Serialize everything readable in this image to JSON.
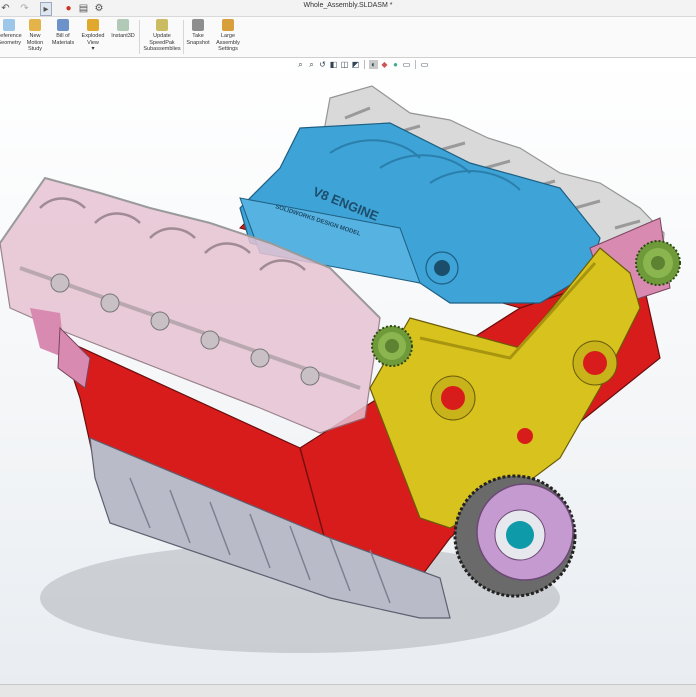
{
  "window": {
    "title": "Whole_Assembly.SLDASM *"
  },
  "quick_access": {
    "icons": [
      "undo-icon",
      "redo-icon",
      "select-icon",
      "rebuild-icon",
      "file-properties-icon",
      "options-icon"
    ]
  },
  "ribbon": {
    "buttons": [
      {
        "id": "reference-geometry",
        "label": "Reference\nGeometry",
        "icon": "reference-geometry-icon"
      },
      {
        "id": "new-motion-study",
        "label": "New\nMotion\nStudy",
        "icon": "motion-study-icon"
      },
      {
        "id": "bill-of-materials",
        "label": "Bill of\nMaterials",
        "icon": "bom-icon"
      },
      {
        "id": "exploded-view",
        "label": "Exploded\nView",
        "icon": "exploded-view-icon"
      },
      {
        "id": "instant3d",
        "label": "Instant3D",
        "icon": "instant3d-icon"
      },
      {
        "id": "update-speedpak",
        "label": "Update\nSpeedPak\nSubassemblies",
        "icon": "speedpak-icon"
      },
      {
        "id": "take-snapshot",
        "label": "Take\nSnapshot",
        "icon": "camera-icon"
      },
      {
        "id": "large-assembly-settings",
        "label": "Large\nAssembly\nSettings",
        "icon": "large-assembly-icon"
      }
    ]
  },
  "heads_up_toolbar": {
    "icons": [
      "zoom-to-fit-icon",
      "zoom-to-area-icon",
      "previous-view-icon",
      "section-view-icon",
      "view-orientation-icon",
      "display-style-icon",
      "hide-show-icon",
      "edit-appearance-icon",
      "apply-scene-icon",
      "view-settings-icon",
      "display-pane-icon"
    ]
  },
  "model": {
    "engraving_main": "V8 ENGINE",
    "engraving_sub": "SOLIDWORKS DESIGN MODEL",
    "colors": {
      "block_red": "#d81c1c",
      "manifold_blue": "#3ea3d6",
      "cover_yellow": "#d8c21e",
      "head_pink": "#d88ab0",
      "pan_gray": "#b9bcc8",
      "pulley_lilac": "#c59ad1",
      "gear_green": "#6f9a3a",
      "glass_gray": "#cfcfcf"
    }
  }
}
